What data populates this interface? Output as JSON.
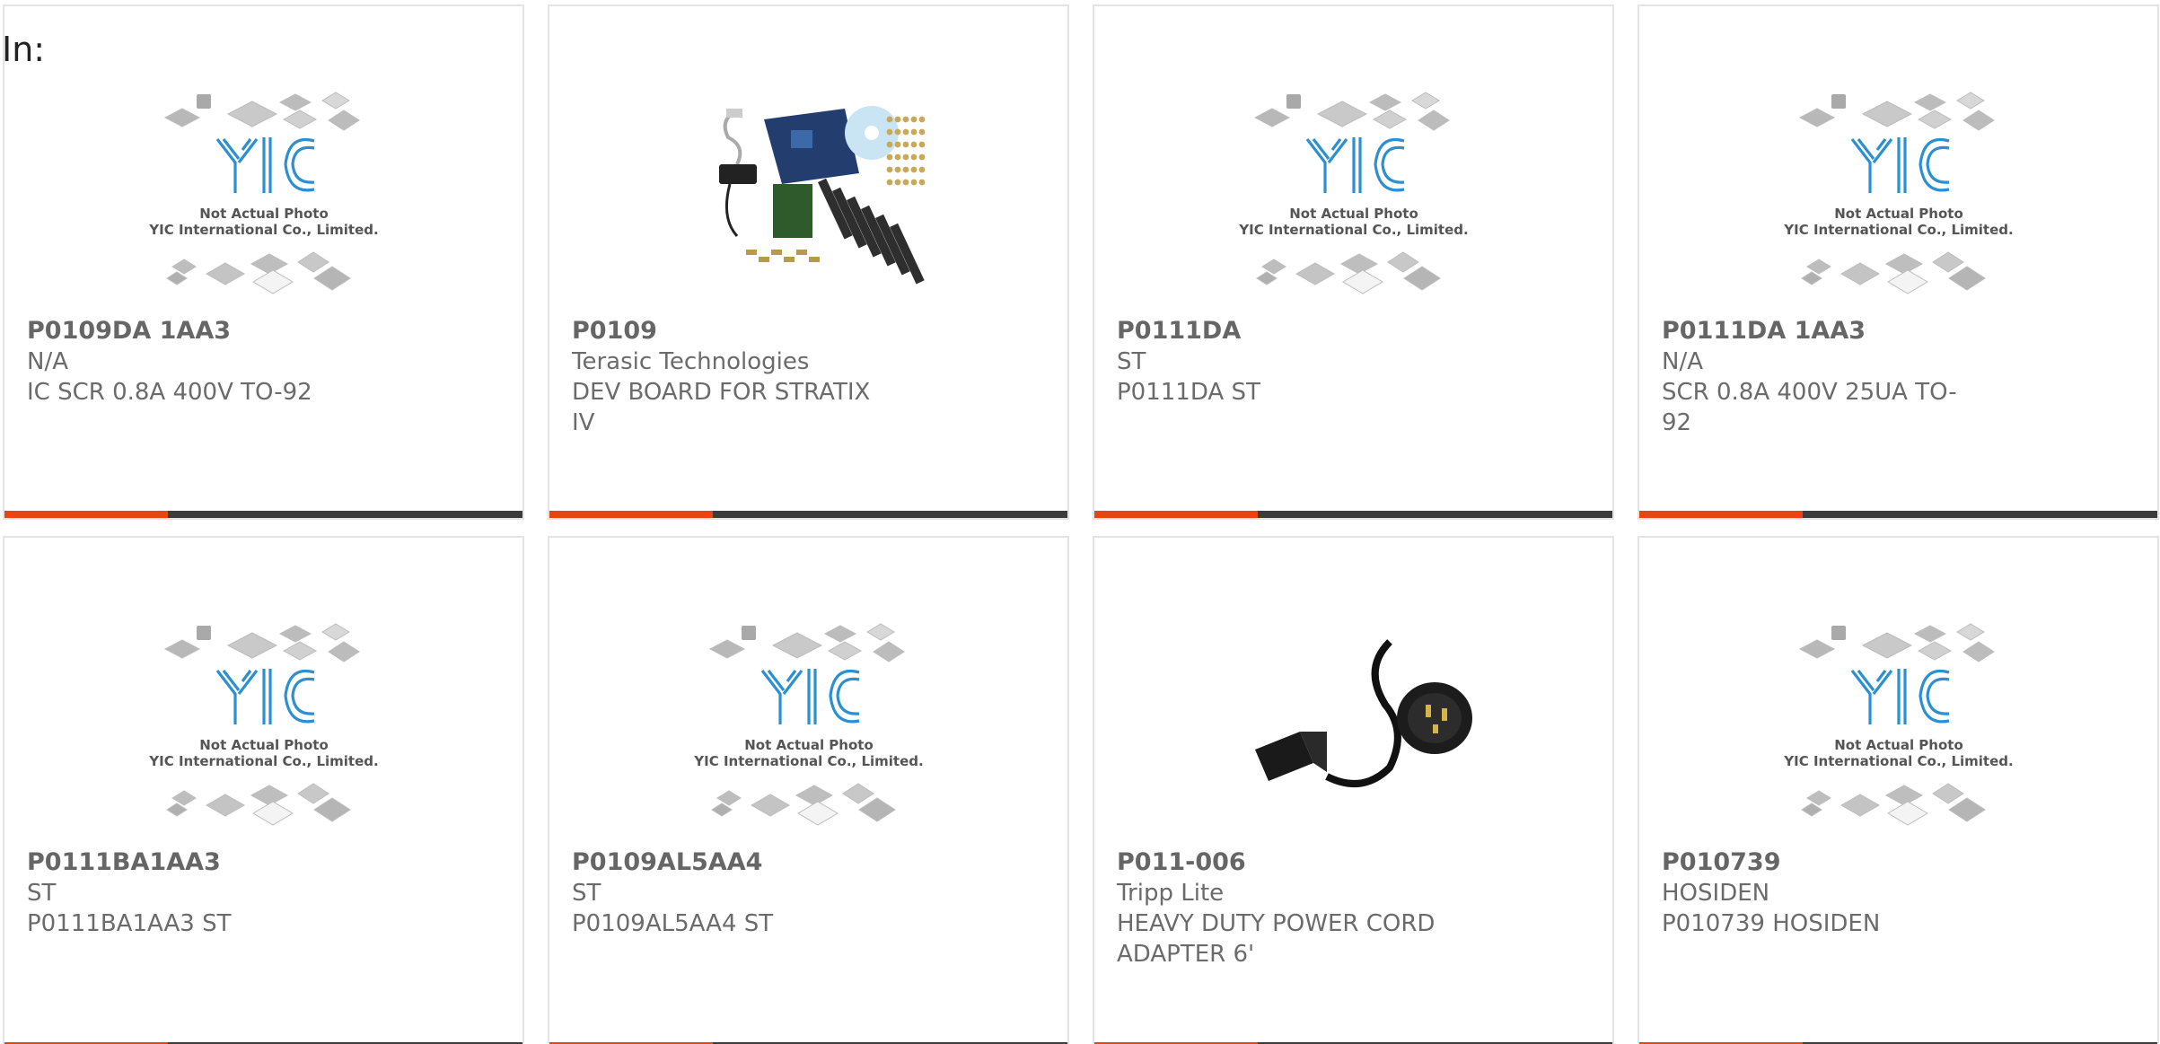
{
  "page": {
    "in_label": "In:"
  },
  "accent_color": "#e84418",
  "bar_color": "#3c3c3c",
  "placeholder_text": {
    "line1": "Not Actual Photo",
    "line2": "YIC International Co., Limited.",
    "logo": "YIC"
  },
  "products": [
    {
      "part_number": "P0109DA 1AA3",
      "manufacturer": "N/A",
      "description": "IC SCR 0.8A 400V TO-92",
      "image": "yic-placeholder-image"
    },
    {
      "part_number": "P0109",
      "manufacturer": "Terasic Technologies",
      "description": "DEV BOARD FOR STRATIX IV",
      "image": "dev-board-kit-image"
    },
    {
      "part_number": "P0111DA",
      "manufacturer": "ST",
      "description": "P0111DA ST",
      "image": "yic-placeholder-image"
    },
    {
      "part_number": "P0111DA 1AA3",
      "manufacturer": "N/A",
      "description": "SCR 0.8A 400V 25UA TO-92",
      "image": "yic-placeholder-image"
    },
    {
      "part_number": "P0111BA1AA3",
      "manufacturer": "ST",
      "description": "P0111BA1AA3 ST",
      "image": "yic-placeholder-image"
    },
    {
      "part_number": "P0109AL5AA4",
      "manufacturer": "ST",
      "description": "P0109AL5AA4 ST",
      "image": "yic-placeholder-image"
    },
    {
      "part_number": "P011-006",
      "manufacturer": "Tripp Lite",
      "description": "HEAVY DUTY POWER CORD ADAPTER 6'",
      "image": "power-cord-image"
    },
    {
      "part_number": "P010739",
      "manufacturer": "HOSIDEN",
      "description": "P010739 HOSIDEN",
      "image": "yic-placeholder-image"
    }
  ]
}
